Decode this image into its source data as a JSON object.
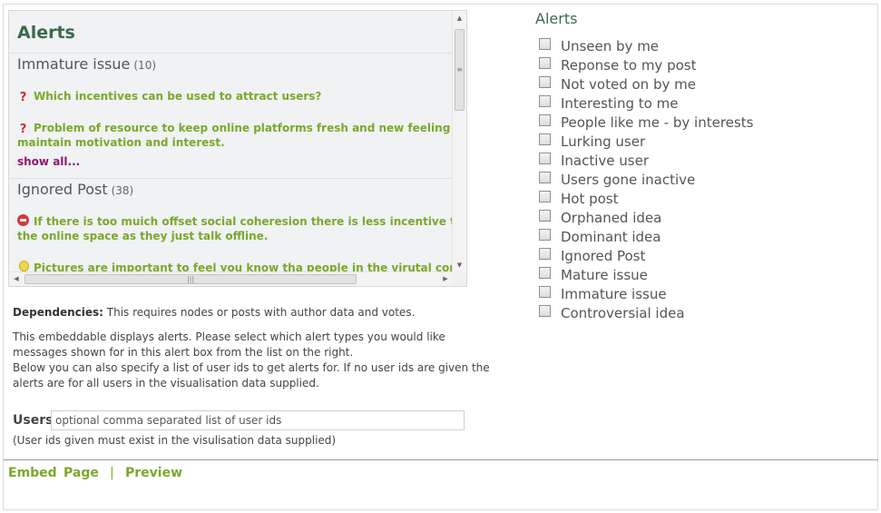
{
  "preview": {
    "title": "Alerts",
    "sections": [
      {
        "name": "Immature issue",
        "count": "(10)",
        "items": [
          {
            "icon": "question-icon",
            "text": "Which incentives can be used to attract users?"
          },
          {
            "icon": "question-icon",
            "text": "Problem of resource to keep online platforms fresh and new feeling to maintain motivation and interest."
          }
        ],
        "show_all": "show all..."
      },
      {
        "name": "Ignored Post",
        "count": "(38)",
        "items": [
          {
            "icon": "con-icon",
            "text": "If there is too muich offset social coheresion there is less incentive to use the online space as they just talk offline."
          },
          {
            "icon": "idea-icon",
            "text": "Pictures are important to feel you know tha people in the virutal community"
          }
        ]
      }
    ]
  },
  "dependencies": {
    "label": "Dependencies:",
    "text": " This requires nodes or posts with author data and votes."
  },
  "description": {
    "line1": "This embeddable displays alerts. Please select which alert types you would like",
    "line2": "messages shown for in this alert box from the list on the right.",
    "line3": "Below you can also specify a list of user ids to get alerts for. If no user ids are given the",
    "line4": "alerts are for all users in the visualisation data supplied."
  },
  "users": {
    "label": "Users",
    "placeholder": "optional comma separated list of user ids",
    "note": "(User ids given must exist in the visulisation data supplied)"
  },
  "footer": {
    "embed": "Embed",
    "page": "Page",
    "separator": "|",
    "preview": "Preview"
  },
  "alert_types": {
    "title": "Alerts",
    "items": [
      "Unseen by me",
      "Reponse to my post",
      "Not voted on by me",
      "Interesting to me",
      "People like me - by interests",
      "Lurking user",
      "Inactive user",
      "Users gone inactive",
      "Hot post",
      "Orphaned idea",
      "Dominant idea",
      "Ignored Post",
      "Mature issue",
      "Immature issue",
      "Controversial idea"
    ]
  },
  "colors": {
    "accent_green": "#7aa82c",
    "title_green": "#3c6a4a",
    "show_all_purple": "#8b1a6b"
  }
}
